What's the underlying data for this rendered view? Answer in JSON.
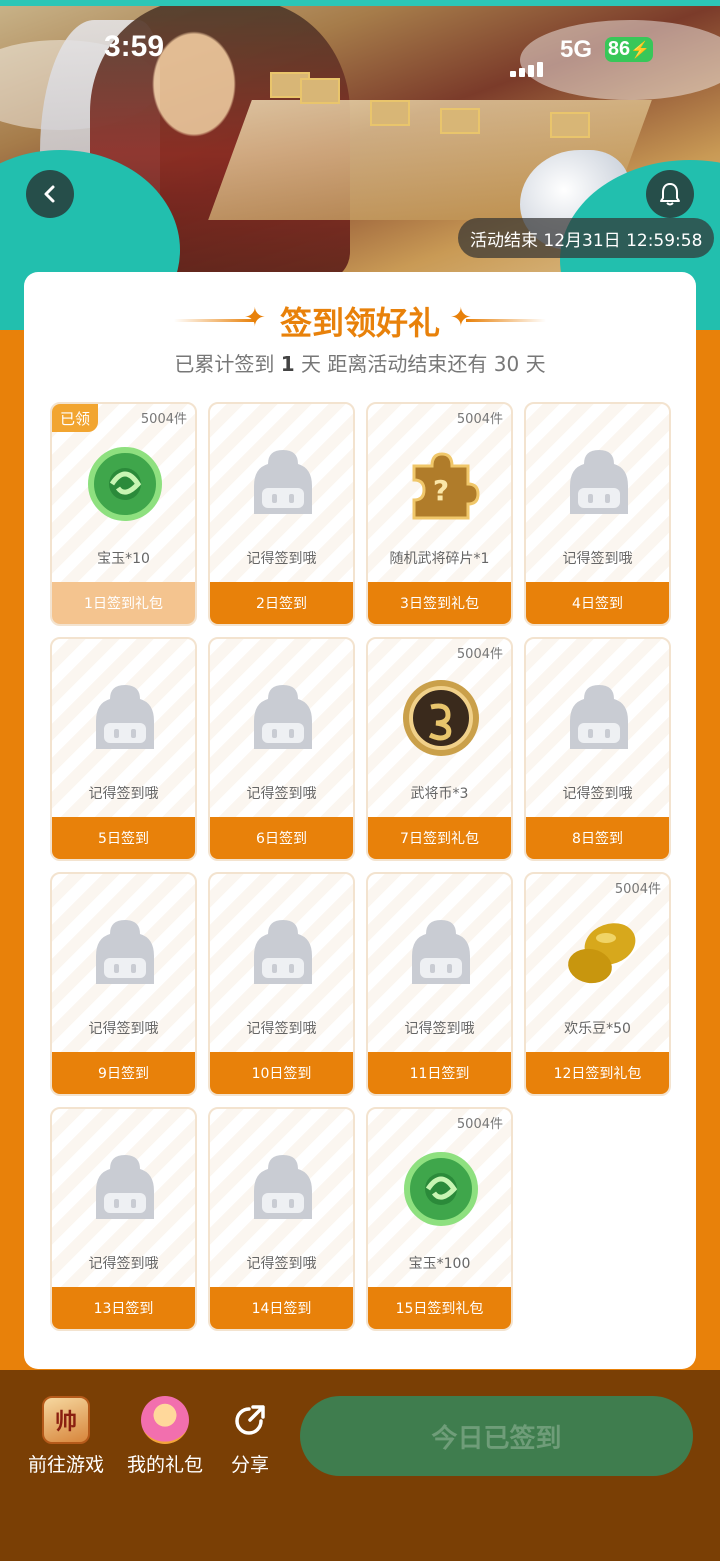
{
  "status_bar": {
    "time": "3:59",
    "network": "5G",
    "battery": "86"
  },
  "header": {
    "activity_end_text": "活动结束 12月31日 12:59:58",
    "back_icon": "chevron-left-icon",
    "bell_icon": "bell-icon"
  },
  "card": {
    "title": "签到领好礼",
    "subtitle_prefix": "已累计签到",
    "subtitle_days": "1",
    "subtitle_mid": "天  距离活动结束还有 30 天"
  },
  "claimed_badge": "已领",
  "days": [
    {
      "footer": "1日签到礼包",
      "name": "宝玉*10",
      "count": "5004件",
      "icon": "jade-icon",
      "claimed": true
    },
    {
      "footer": "2日签到",
      "name": "记得签到哦",
      "count": "",
      "icon": "placeholder-icon"
    },
    {
      "footer": "3日签到礼包",
      "name": "随机武将碎片*1",
      "count": "5004件",
      "icon": "puzzle-piece-icon"
    },
    {
      "footer": "4日签到",
      "name": "记得签到哦",
      "count": "",
      "icon": "placeholder-icon"
    },
    {
      "footer": "5日签到",
      "name": "记得签到哦",
      "count": "",
      "icon": "placeholder-icon"
    },
    {
      "footer": "6日签到",
      "name": "记得签到哦",
      "count": "",
      "icon": "placeholder-icon"
    },
    {
      "footer": "7日签到礼包",
      "name": "武将币*3",
      "count": "5004件",
      "icon": "coin-icon"
    },
    {
      "footer": "8日签到",
      "name": "记得签到哦",
      "count": "",
      "icon": "placeholder-icon"
    },
    {
      "footer": "9日签到",
      "name": "记得签到哦",
      "count": "",
      "icon": "placeholder-icon"
    },
    {
      "footer": "10日签到",
      "name": "记得签到哦",
      "count": "",
      "icon": "placeholder-icon"
    },
    {
      "footer": "11日签到",
      "name": "记得签到哦",
      "count": "",
      "icon": "placeholder-icon"
    },
    {
      "footer": "12日签到礼包",
      "name": "欢乐豆*50",
      "count": "5004件",
      "icon": "beans-icon"
    },
    {
      "footer": "13日签到",
      "name": "记得签到哦",
      "count": "",
      "icon": "placeholder-icon"
    },
    {
      "footer": "14日签到",
      "name": "记得签到哦",
      "count": "",
      "icon": "placeholder-icon"
    },
    {
      "footer": "15日签到礼包",
      "name": "宝玉*100",
      "count": "5004件",
      "icon": "jade-icon"
    }
  ],
  "bottom_bar": {
    "go_game": "前往游戏",
    "my_gifts": "我的礼包",
    "share": "分享",
    "signed_today": "今日已签到"
  },
  "colors": {
    "accent": "#e8810a",
    "bottom_bg": "#7a3f05",
    "signed_button": "#3f7d4e"
  }
}
